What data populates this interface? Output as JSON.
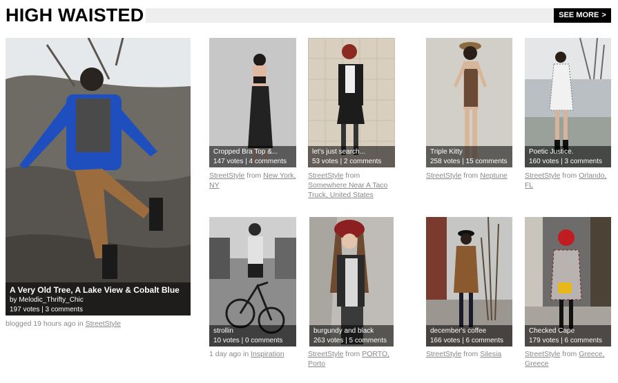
{
  "header": {
    "title": "HIGH WAISTED",
    "see_more": "SEE MORE",
    "see_more_arrow": ">"
  },
  "featured": {
    "title": "A Very Old Tree, A Lake View & Cobalt Blue",
    "by_prefix": "by",
    "author": "Melodic_Thrifty_Chic",
    "stats": "197 votes | 3 comments",
    "meta_prefix": "blogged 19 hours ago in",
    "meta_link": "StreetStyle"
  },
  "posts": [
    {
      "title": "Cropped Bra Top &...",
      "stats": "147 votes | 4 comments",
      "link1": "StreetStyle",
      "mid": "from",
      "link2": "New York, NY"
    },
    {
      "title": "let's just search...",
      "stats": "53 votes | 2 comments",
      "link1": "StreetStyle",
      "mid": "from",
      "link2": "Somewhere Near A Taco Truck, United States"
    },
    {
      "title": "Triple Kitty",
      "stats": "258 votes | 15 comments",
      "link1": "StreetStyle",
      "mid": "from",
      "link2": "Neptune"
    },
    {
      "title": "Poetic Justice.",
      "stats": "160 votes | 3 comments",
      "link1": "StreetStyle",
      "mid": "from",
      "link2": "Orlando, FL"
    },
    {
      "title": "strollin",
      "stats": "10 votes | 0 comments",
      "pre": "1 day ago in",
      "link2": "Inspiration"
    },
    {
      "title": "burgundy and black",
      "stats": "263 votes | 5 comments",
      "link1": "StreetStyle",
      "mid": "from",
      "link2": "PORTO, Porto"
    },
    {
      "title": "december's coffee",
      "stats": "166 votes | 6 comments",
      "link1": "StreetStyle",
      "mid": "from",
      "link2": "Silesia"
    },
    {
      "title": "Checked Cape",
      "stats": "179 votes | 6 comments",
      "link1": "StreetStyle",
      "mid": "from",
      "link2": "Greece, Greece"
    }
  ],
  "colors": {
    "header_bar": "#eeeeee",
    "button_bg": "#000000",
    "link": "#888888",
    "overlay": "rgba(0,0,0,0.55)"
  }
}
